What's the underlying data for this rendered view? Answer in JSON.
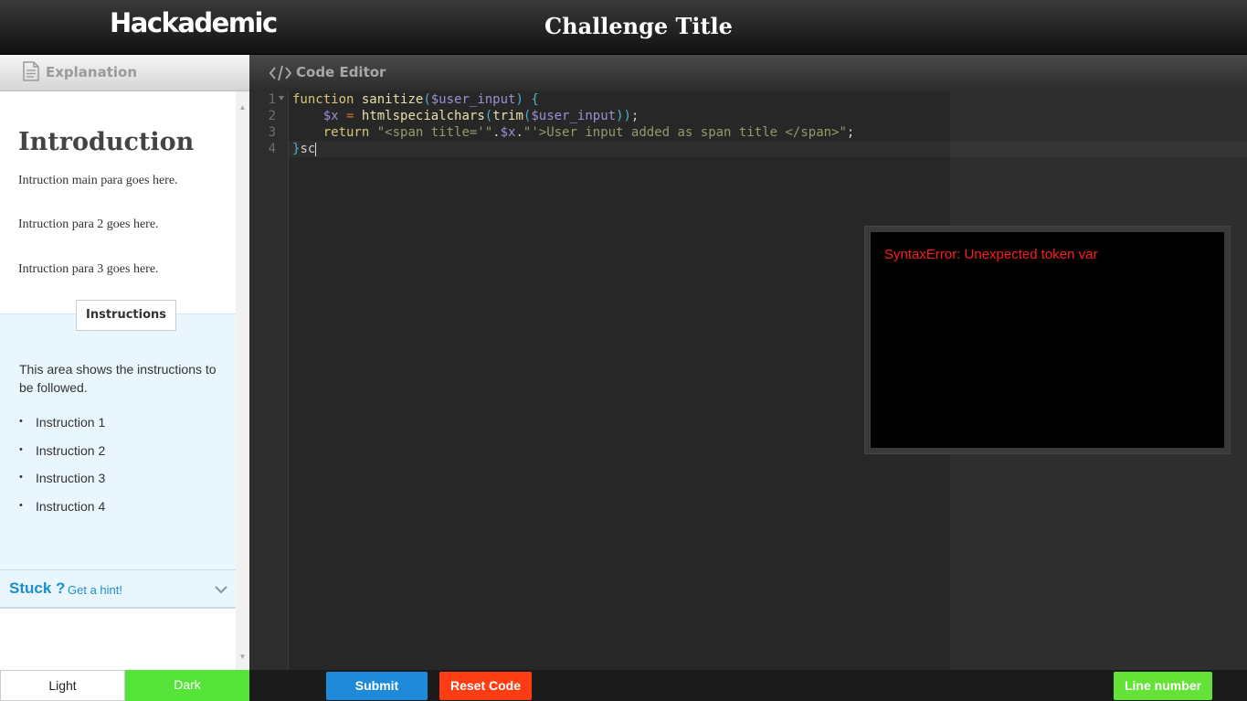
{
  "header": {
    "brand": "Hackademic",
    "challenge_title": "Challenge Title"
  },
  "left_panel": {
    "header_label": "Explanation",
    "intro_title": "Introduction",
    "paragraphs": [
      "Intruction main para goes here.",
      "Intruction para 2 goes here.",
      "Intruction para 3 goes here."
    ],
    "instructions_tab": "Instructions",
    "instructions_desc": "This area shows the instructions to be followed.",
    "instructions": [
      "Instruction 1",
      "Instruction 2",
      "Instruction 3",
      "Instruction 4"
    ],
    "hint_stuck": "Stuck ?",
    "hint_link": "Get a hint!"
  },
  "editor": {
    "header_label": "Code Editor",
    "line_numbers": [
      "1",
      "2",
      "3",
      "4"
    ],
    "code": {
      "l1_kw": "function",
      "l1_name": "sanitize",
      "l1_open": "(",
      "l1_param": "$user_input",
      "l1_close": ")",
      "l1_brace": "{",
      "l2_var": "$x",
      "l2_eq": "=",
      "l2_fn1": "htmlspecialchars",
      "l2_p1": "(",
      "l2_fn2": "trim",
      "l2_p2": "(",
      "l2_param": "$user_input",
      "l2_close": "))",
      "l2_semi": ";",
      "l3_kw": "return",
      "l3_str1": "\"<span title='\"",
      "l3_dot1": ".",
      "l3_var": "$x",
      "l3_dot2": ".",
      "l3_str2": "\"'>User input added as span title </span>\"",
      "l3_semi": ";",
      "l4_brace": "}",
      "l4_text": "sc"
    },
    "error_message": "SyntaxError: Unexpected token var"
  },
  "footer": {
    "theme_light": "Light",
    "theme_dark": "Dark",
    "submit": "Submit",
    "reset": "Reset Code",
    "line_number": "Line number"
  },
  "colors": {
    "accent_blue": "#1f8ad9",
    "reset_red": "#ff3c13",
    "green": "#55e33a",
    "error_red": "#ff1d1d"
  }
}
